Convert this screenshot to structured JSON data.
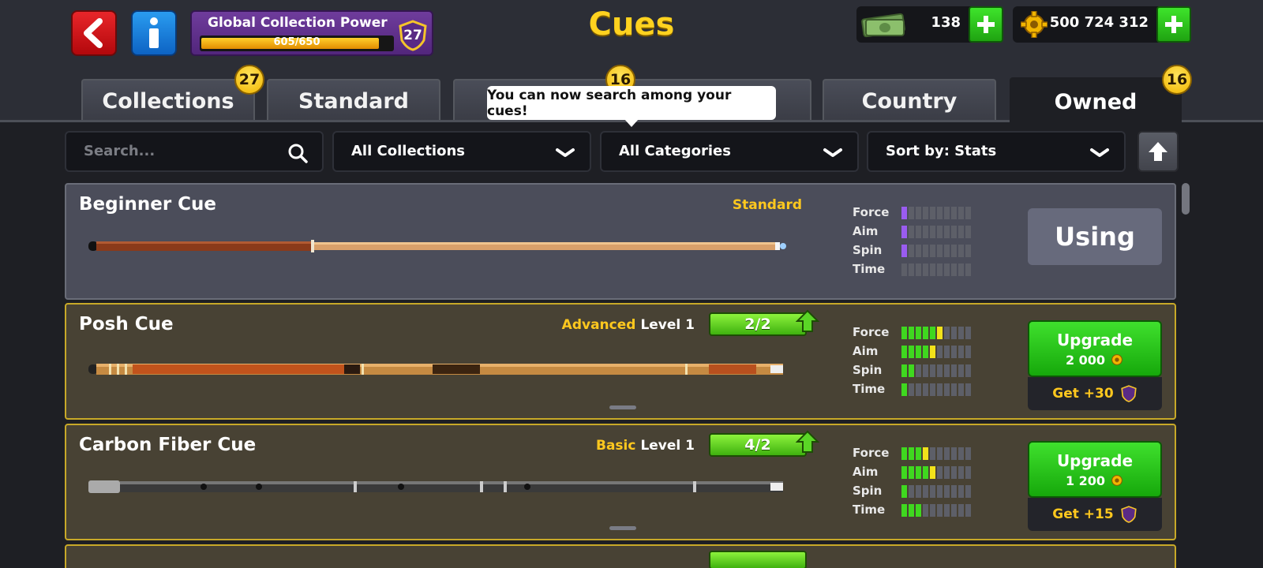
{
  "header": {
    "title": "Cues",
    "back_label": "Back",
    "info_label": "Info",
    "collection_power": {
      "title": "Global Collection Power",
      "value_text": "605/650",
      "progress": 0.93,
      "level": "27"
    },
    "cash": {
      "amount": "138"
    },
    "coins": {
      "amount": "500 724 312"
    }
  },
  "tabs": [
    {
      "label": "Collections",
      "badge": "27",
      "active": false
    },
    {
      "label": "Standard",
      "badge": "",
      "active": false
    },
    {
      "label": "",
      "badge": "16",
      "active": false
    },
    {
      "label": "Country",
      "badge": "",
      "active": false
    },
    {
      "label": "Owned",
      "badge": "16",
      "active": true
    }
  ],
  "tooltip": "You can now search among your cues!",
  "filters": {
    "search_placeholder": "Search...",
    "collections": "All Collections",
    "categories": "All Categories",
    "sort": "Sort by: Stats"
  },
  "cues": [
    {
      "name": "Beginner Cue",
      "category": "Standard",
      "level_label": "",
      "level_progress": "",
      "stats": {
        "Force": 1,
        "Aim": 1,
        "Spin": 1,
        "Time": 0
      },
      "stat_colors": {
        "Force": "purple",
        "Aim": "purple",
        "Spin": "purple",
        "Time": "none"
      },
      "action": "Using",
      "state": "using"
    },
    {
      "name": "Posh Cue",
      "category": "Advanced",
      "level_label": "Level 1",
      "level_progress": "2/2",
      "stats": {
        "Force": 5,
        "Aim": 4,
        "Spin": 2,
        "Time": 1
      },
      "stat_next": {
        "Force": 1,
        "Aim": 1,
        "Spin": 0,
        "Time": 0
      },
      "action": "Upgrade",
      "cost": "2 000",
      "bonus": "Get +30",
      "state": "upgrade"
    },
    {
      "name": "Carbon Fiber Cue",
      "category": "Basic",
      "level_label": "Level 1",
      "level_progress": "4/2",
      "stats": {
        "Force": 3,
        "Aim": 4,
        "Spin": 1,
        "Time": 3
      },
      "stat_next": {
        "Force": 1,
        "Aim": 1,
        "Spin": 0,
        "Time": 0
      },
      "action": "Upgrade",
      "cost": "1 200",
      "bonus": "Get +15",
      "state": "upgrade"
    }
  ],
  "colors": {
    "accent_yellow": "#ffc81e",
    "stat_green": "#3fd81f",
    "stat_yellow": "#f2e21a",
    "stat_purple": "#9a5cf0"
  }
}
